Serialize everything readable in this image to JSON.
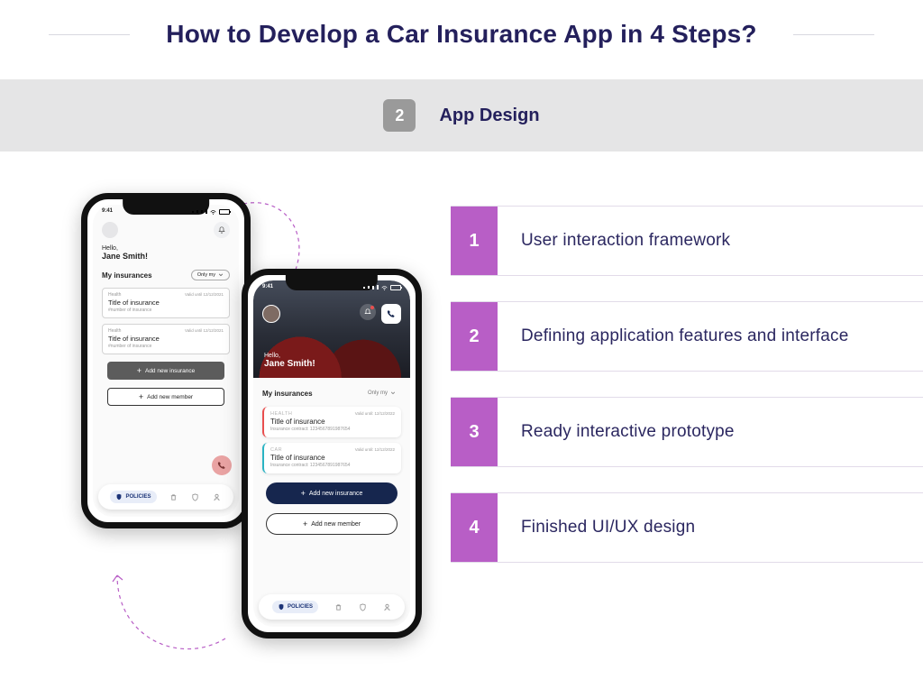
{
  "title": "How to Develop a Car Insurance App in 4 Steps?",
  "current_step": {
    "number": "2",
    "label": "App Design"
  },
  "steps": [
    {
      "num": "1",
      "text": "User interaction framework"
    },
    {
      "num": "2",
      "text": "Defining application features and interface"
    },
    {
      "num": "3",
      "text": "Ready interactive prototype"
    },
    {
      "num": "4",
      "text": "Finished UI/UX design"
    }
  ],
  "colors": {
    "step_chip": "#9a9a9a",
    "step_num": "#b85ec6",
    "title": "#24205c"
  },
  "phone_a": {
    "time": "9:41",
    "hello": "Hello,",
    "name": "Jane Smith!",
    "section": "My insurances",
    "filter": "Only my",
    "cards": [
      {
        "category": "Health",
        "title": "Title of insurance",
        "subtitle": "#number of insurance",
        "valid": "Valid until 12/12/2021"
      },
      {
        "category": "Health",
        "title": "Title of insurance",
        "subtitle": "#number of insurance",
        "valid": "Valid until 12/12/2021"
      }
    ],
    "btn_primary": "Add new insurance",
    "btn_secondary": "Add new member",
    "tab_active": "POLICIES",
    "icons": {
      "bell": "bell-icon",
      "trash": "trash-icon",
      "shield": "shield-icon",
      "user": "user-icon",
      "phone": "phone-icon"
    }
  },
  "phone_b": {
    "time": "9:41",
    "hello": "Hello,",
    "name": "Jane Smith!",
    "section": "My insurances",
    "filter": "Only my",
    "cards": [
      {
        "category": "HEALTH",
        "title": "Title of insurance",
        "subtitle_label": "Insurance contract:",
        "subtitle_value": "1234567891987654",
        "valid": "Valid until: 12/12/2022"
      },
      {
        "category": "CAR",
        "title": "Title of insurance",
        "subtitle_label": "Insurance contract:",
        "subtitle_value": "1234567891987654",
        "valid": "Valid until: 12/12/2022"
      }
    ],
    "btn_primary": "Add new insurance",
    "btn_secondary": "Add new member",
    "tab_active": "POLICIES"
  }
}
